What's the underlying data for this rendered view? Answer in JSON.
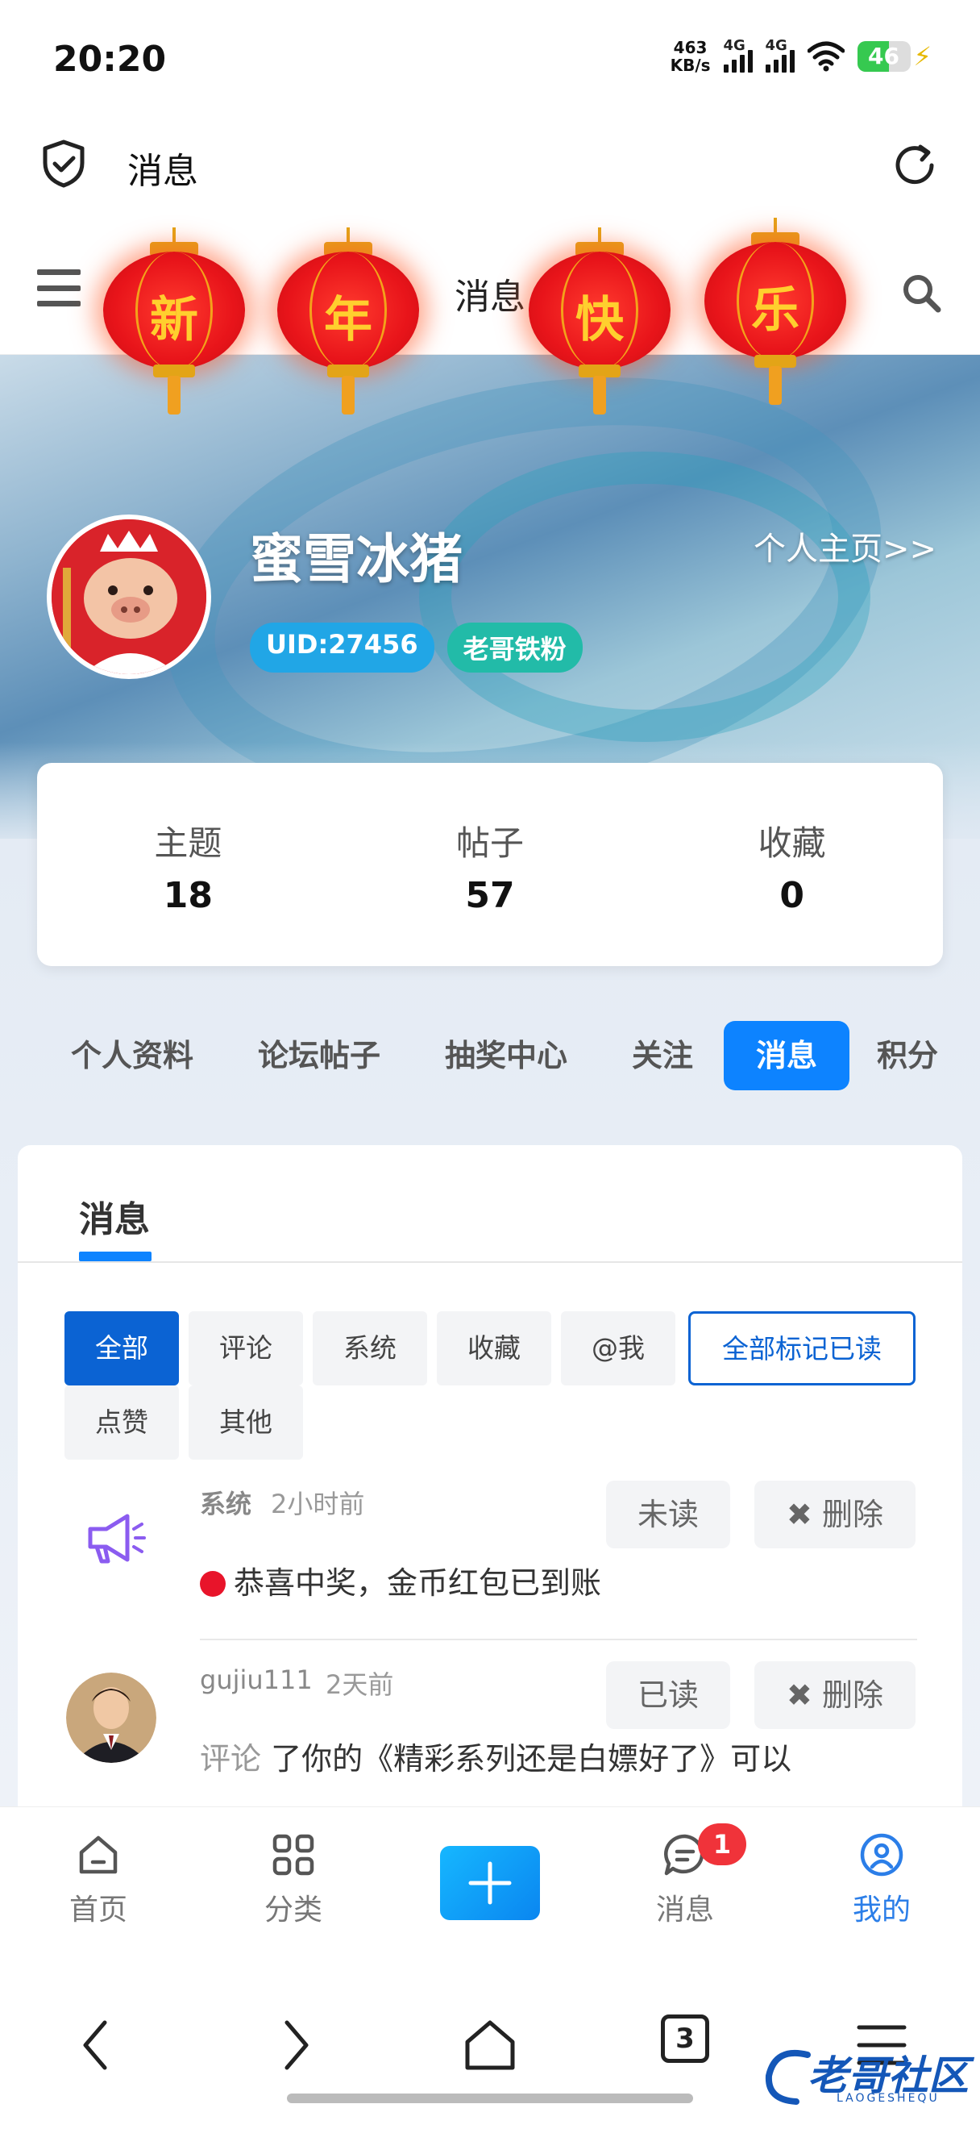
{
  "status_bar": {
    "time": "20:20",
    "net_speed_value": "463",
    "net_speed_unit": "KB/s",
    "sim1": "4G",
    "sim2": "4G",
    "battery": "46"
  },
  "app_bar": {
    "title": "消息"
  },
  "site_header": {
    "title": "消息",
    "lanterns": [
      "新",
      "年",
      "快",
      "乐"
    ]
  },
  "profile": {
    "username": "蜜雪冰猪",
    "homepage_link": "个人主页>>",
    "uid": "UID:27456",
    "fan_badge": "老哥铁粉"
  },
  "stats": [
    {
      "label": "主题",
      "value": "18"
    },
    {
      "label": "帖子",
      "value": "57"
    },
    {
      "label": "收藏",
      "value": "0"
    }
  ],
  "profile_tabs": [
    "个人资料",
    "论坛帖子",
    "抽奖中心",
    "关注",
    "消息",
    "积分"
  ],
  "messages_panel": {
    "title": "消息",
    "filters": [
      "全部",
      "评论",
      "系统",
      "收藏",
      "@我",
      "点赞",
      "其他"
    ],
    "mark_all_read": "全部标记已读",
    "items": [
      {
        "sender": "系统",
        "time": "2小时前",
        "status_button": "未读",
        "delete_button": "✖ 删除",
        "text": "恭喜中奖，金币红包已到账"
      },
      {
        "sender": "gujiu111",
        "time": "2天前",
        "status_button": "已读",
        "delete_button": "✖ 删除",
        "action": "评论",
        "text": "了你的《精彩系列还是白嫖好了》可以"
      }
    ]
  },
  "bottom_nav": {
    "items": [
      "首页",
      "分类",
      "消息",
      "我的"
    ],
    "message_badge": "1"
  },
  "system_nav": {
    "tab_count": "3"
  },
  "watermark": {
    "text": "老哥社区",
    "sub": "LAOGESHEQU"
  },
  "colors": {
    "accent": "#0d83ff",
    "filter_active": "#0b63d3",
    "badge_red": "#f0333a"
  }
}
